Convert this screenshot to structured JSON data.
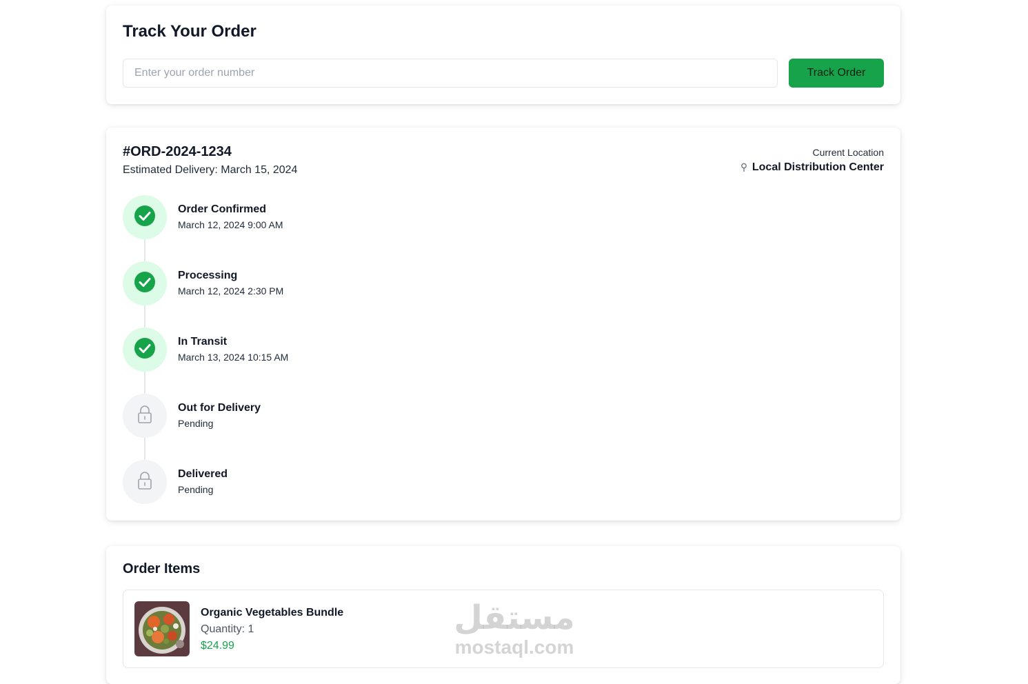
{
  "track": {
    "title": "Track Your Order",
    "input_placeholder": "Enter your order number",
    "input_value": "",
    "button_label": "Track Order"
  },
  "order": {
    "id": "#ORD-2024-1234",
    "estimated_delivery": "Estimated Delivery: March 15, 2024",
    "location_label": "Current Location",
    "location_value": "Local Distribution Center"
  },
  "steps": [
    {
      "title": "Order Confirmed",
      "sub": "March 12, 2024 9:00 AM",
      "status": "done",
      "icon": "check-circle-icon"
    },
    {
      "title": "Processing",
      "sub": "March 12, 2024 2:30 PM",
      "status": "done",
      "icon": "check-circle-icon"
    },
    {
      "title": "In Transit",
      "sub": "March 13, 2024 10:15 AM",
      "status": "done",
      "icon": "check-circle-icon"
    },
    {
      "title": "Out for Delivery",
      "sub": "Pending",
      "status": "pending",
      "icon": "lock-icon"
    },
    {
      "title": "Delivered",
      "sub": "Pending",
      "status": "pending",
      "icon": "lock-icon"
    }
  ],
  "items": {
    "title": "Order Items",
    "list": [
      {
        "name": "Organic Vegetables Bundle",
        "quantity": "Quantity: 1",
        "price": "$24.99",
        "image": "vegetables-photo"
      }
    ]
  },
  "watermark": {
    "arabic": "مستقل",
    "latin": "mostaql.com"
  },
  "colors": {
    "accent": "#16a34a",
    "done_bg": "#dcfce7",
    "pending_bg": "#f3f4f6"
  }
}
